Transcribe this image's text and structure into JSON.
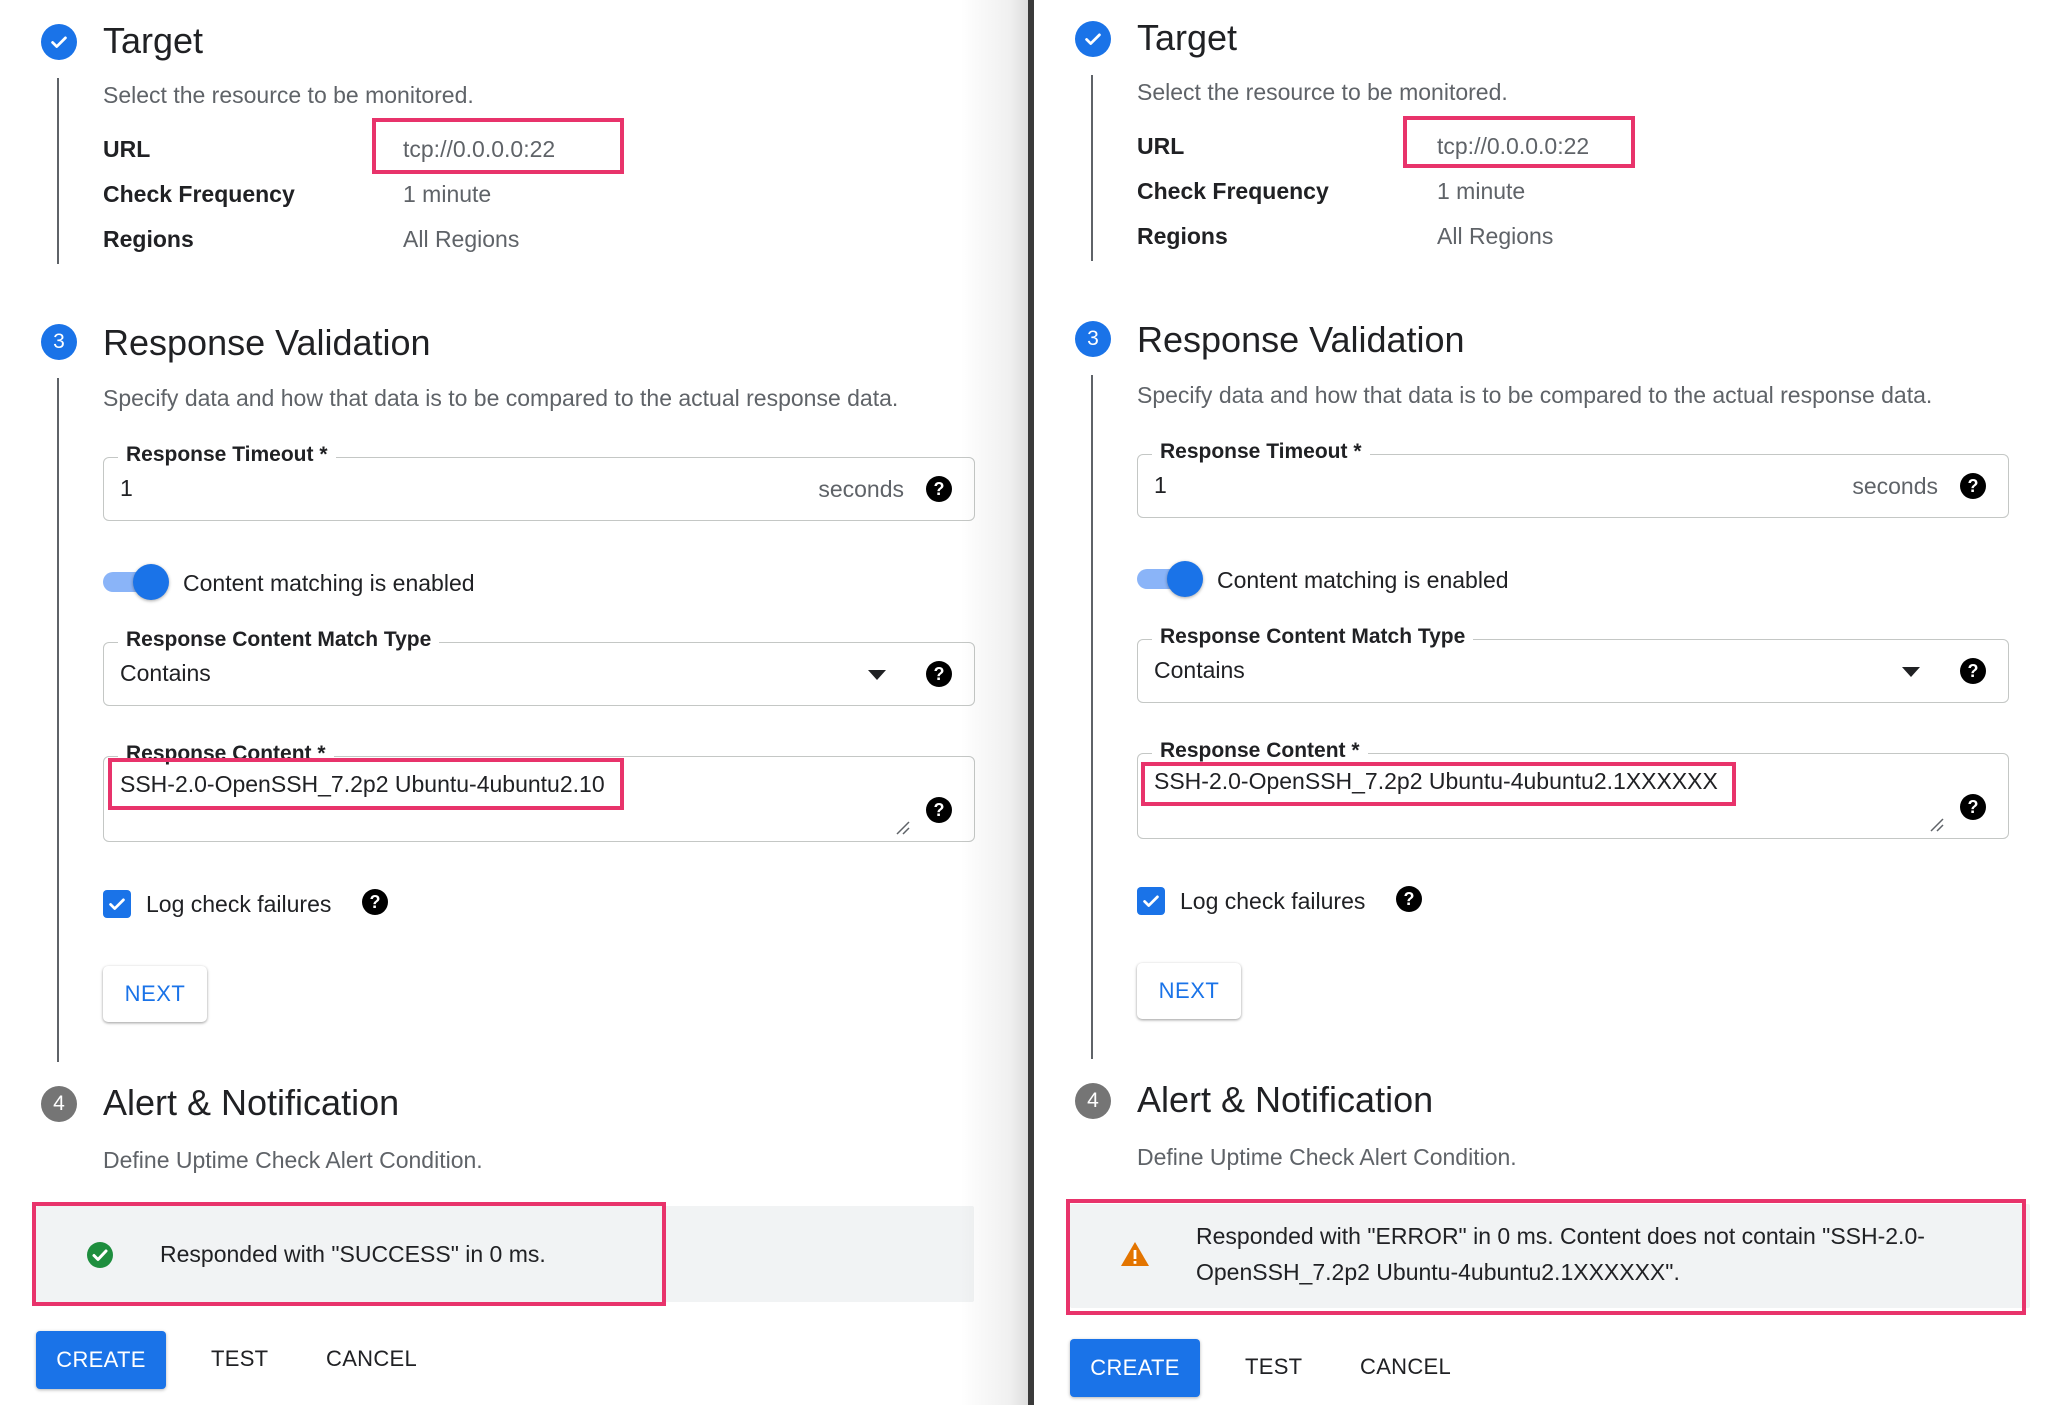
{
  "colors": {
    "accent": "#1a73e8",
    "highlight": "#e8336b",
    "success": "#1e8e3e",
    "warning": "#e37400"
  },
  "left": {
    "target": {
      "title": "Target",
      "subtitle": "Select the resource to be monitored.",
      "url_label": "URL",
      "url_value": "tcp://0.0.0.0:22",
      "freq_label": "Check Frequency",
      "freq_value": "1 minute",
      "regions_label": "Regions",
      "regions_value": "All Regions"
    },
    "validation": {
      "step_number": "3",
      "title": "Response Validation",
      "subtitle": "Specify data and how that data is to be compared to the actual response data.",
      "timeout_label": "Response Timeout *",
      "timeout_value": "1",
      "timeout_suffix": "seconds",
      "toggle_label": "Content matching is enabled",
      "match_type_label": "Response Content Match Type",
      "match_type_value": "Contains",
      "content_label": "Response Content *",
      "content_value": "SSH-2.0-OpenSSH_7.2p2 Ubuntu-4ubuntu2.10",
      "log_label": "Log check failures",
      "next_label": "NEXT"
    },
    "alert": {
      "step_number": "4",
      "title": "Alert & Notification",
      "subtitle": "Define Uptime Check Alert Condition."
    },
    "result": {
      "status_icon": "check-circle-icon",
      "text": "Responded with \"SUCCESS\" in 0 ms."
    },
    "actions": {
      "create": "CREATE",
      "test": "TEST",
      "cancel": "CANCEL"
    }
  },
  "right": {
    "target": {
      "title": "Target",
      "subtitle": "Select the resource to be monitored.",
      "url_label": "URL",
      "url_value": "tcp://0.0.0.0:22",
      "freq_label": "Check Frequency",
      "freq_value": "1 minute",
      "regions_label": "Regions",
      "regions_value": "All Regions"
    },
    "validation": {
      "step_number": "3",
      "title": "Response Validation",
      "subtitle": "Specify data and how that data is to be compared to the actual response data.",
      "timeout_label": "Response Timeout *",
      "timeout_value": "1",
      "timeout_suffix": "seconds",
      "toggle_label": "Content matching is enabled",
      "match_type_label": "Response Content Match Type",
      "match_type_value": "Contains",
      "content_label": "Response Content *",
      "content_value": "SSH-2.0-OpenSSH_7.2p2 Ubuntu-4ubuntu2.1XXXXXX",
      "log_label": "Log check failures",
      "next_label": "NEXT"
    },
    "alert": {
      "step_number": "4",
      "title": "Alert & Notification",
      "subtitle": "Define Uptime Check Alert Condition."
    },
    "result": {
      "status_icon": "warning-icon",
      "text_line1": "Responded with \"ERROR\" in 0 ms. Content does not contain \"SSH-2.0-",
      "text_line2": "OpenSSH_7.2p2 Ubuntu-4ubuntu2.1XXXXXX\"."
    },
    "actions": {
      "create": "CREATE",
      "test": "TEST",
      "cancel": "CANCEL"
    }
  }
}
